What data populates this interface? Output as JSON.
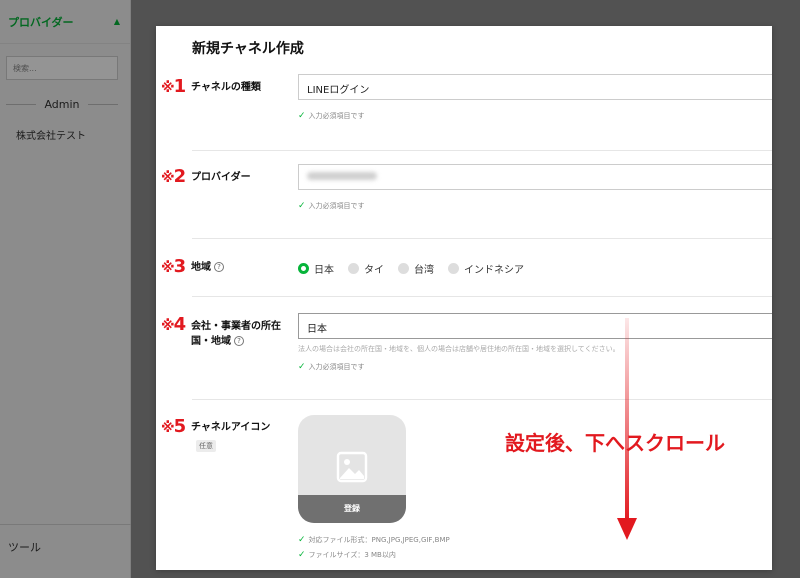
{
  "sidebar": {
    "provider_label": "プロバイダー",
    "search_placeholder": "検索...",
    "admin_label": "Admin",
    "company_item": "株式会社テスト",
    "tools_label": "ツール"
  },
  "modal": {
    "title": "新規チャネル作成",
    "fields": {
      "channel_type": {
        "marker": "1",
        "label": "チャネルの種類",
        "value": "LINEログイン",
        "validation": "入力必須項目です"
      },
      "provider": {
        "marker": "2",
        "label": "プロバイダー",
        "validation": "入力必須項目です"
      },
      "region": {
        "marker": "3",
        "label": "地域",
        "options": [
          "日本",
          "タイ",
          "台湾",
          "インドネシア"
        ],
        "selected": "日本"
      },
      "company_location": {
        "marker": "4",
        "label_line1": "会社・事業者の所在",
        "label_line2": "国・地域",
        "value": "日本",
        "hint": "法人の場合は会社の所在国・地域を、個人の場合は店舗や居住地の所在国・地域を選択してください。",
        "validation": "入力必須項目です"
      },
      "channel_icon": {
        "marker": "5",
        "label": "チャネルアイコン",
        "badge": "任意",
        "register_label": "登録",
        "format_note": "対応ファイル形式：PNG,JPG,JPEG,GIF,BMP",
        "size_note": "ファイルサイズ：3 MB以内"
      }
    },
    "marker_symbol": "※"
  },
  "annotation": {
    "text": "設定後、下へスクロール"
  },
  "colors": {
    "accent_green": "#06b43a",
    "annotation_red": "#e2191f"
  }
}
